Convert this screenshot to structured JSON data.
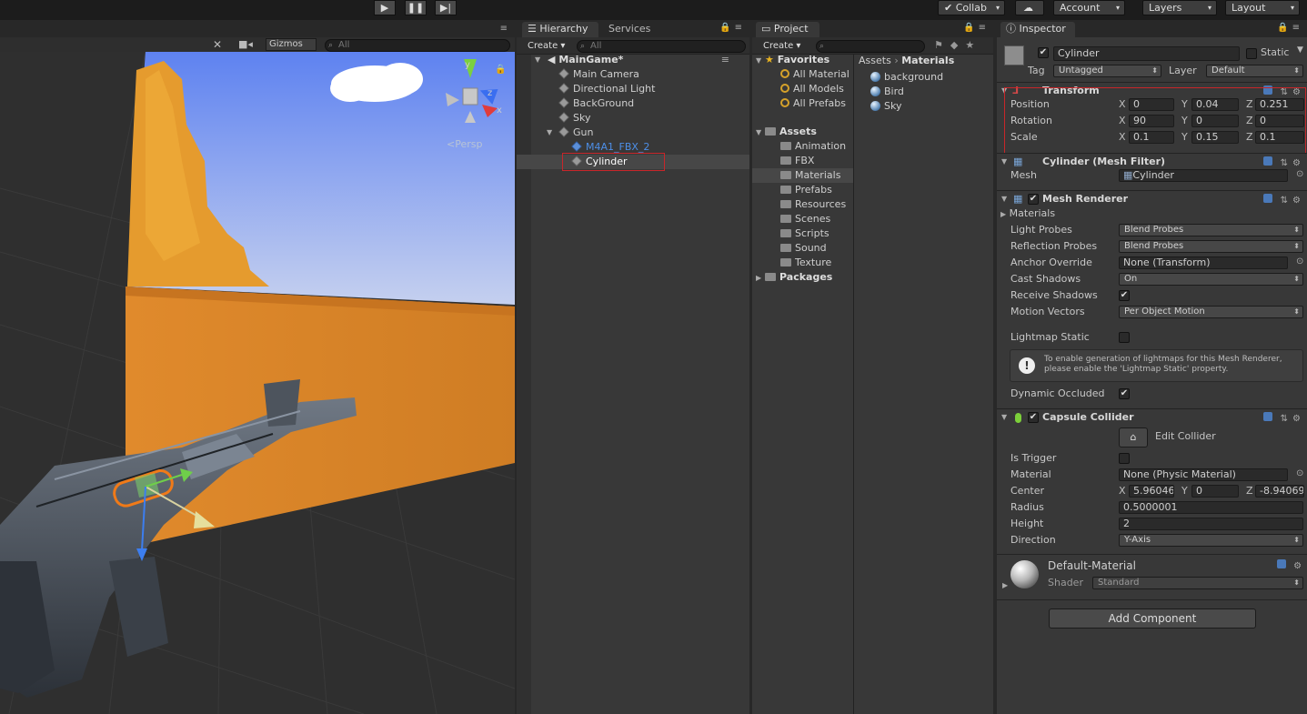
{
  "toolbar": {
    "play_icon": "play-icon",
    "pause_icon": "pause-icon",
    "step_icon": "step-icon",
    "collab_label": "Collab",
    "account_label": "Account",
    "layers_label": "Layers",
    "layout_label": "Layout"
  },
  "scene": {
    "toolbar": {
      "gizmos_label": "Gizmos",
      "search_placeholder": "All"
    },
    "persp_label": "<Persp",
    "axis_labels": {
      "y": "y",
      "z": "z",
      "x": "x"
    }
  },
  "hierarchy": {
    "tabs": [
      "Hierarchy",
      "Services"
    ],
    "create_label": "Create",
    "search_placeholder": "All",
    "scene_name": "MainGame*",
    "items": [
      {
        "label": "Main Camera",
        "depth": 1
      },
      {
        "label": "Directional Light",
        "depth": 1
      },
      {
        "label": "BackGround",
        "depth": 1
      },
      {
        "label": "Sky",
        "depth": 1
      },
      {
        "label": "Gun",
        "depth": 1,
        "expanded": true
      },
      {
        "label": "M4A1_FBX_2",
        "depth": 2,
        "prefab": true
      },
      {
        "label": "Cylinder",
        "depth": 2,
        "selected": true
      }
    ]
  },
  "project": {
    "tab": "Project",
    "create_label": "Create",
    "favorites_label": "Favorites",
    "favorites": [
      "All Material",
      "All Models",
      "All Prefabs"
    ],
    "assets_label": "Assets",
    "asset_folders": [
      "Animation",
      "FBX",
      "Materials",
      "Prefabs",
      "Resources",
      "Scenes",
      "Scripts",
      "Sound",
      "Texture"
    ],
    "selected_folder": "Materials",
    "packages_label": "Packages",
    "breadcrumb": [
      "Assets",
      "Materials"
    ],
    "materials": [
      "background",
      "Bird",
      "Sky"
    ]
  },
  "inspector": {
    "tab": "Inspector",
    "object_name": "Cylinder",
    "static_label": "Static",
    "tag_label": "Tag",
    "tag_value": "Untagged",
    "layer_label": "Layer",
    "layer_value": "Default",
    "transform": {
      "title": "Transform",
      "position_label": "Position",
      "rotation_label": "Rotation",
      "scale_label": "Scale",
      "position": {
        "x": "0",
        "y": "0.04",
        "z": "0.251"
      },
      "rotation": {
        "x": "90",
        "y": "0",
        "z": "0"
      },
      "scale": {
        "x": "0.1",
        "y": "0.15",
        "z": "0.1"
      }
    },
    "mesh_filter": {
      "title": "Cylinder (Mesh Filter)",
      "mesh_label": "Mesh",
      "mesh_value": "Cylinder"
    },
    "mesh_renderer": {
      "title": "Mesh Renderer",
      "materials_label": "Materials",
      "light_probes_label": "Light Probes",
      "light_probes_value": "Blend Probes",
      "reflection_probes_label": "Reflection Probes",
      "reflection_probes_value": "Blend Probes",
      "anchor_override_label": "Anchor Override",
      "anchor_override_value": "None (Transform)",
      "cast_shadows_label": "Cast Shadows",
      "cast_shadows_value": "On",
      "receive_shadows_label": "Receive Shadows",
      "motion_vectors_label": "Motion Vectors",
      "motion_vectors_value": "Per Object Motion",
      "lightmap_static_label": "Lightmap Static",
      "info_text": "To enable generation of lightmaps for this Mesh Renderer, please enable the 'Lightmap Static' property.",
      "dynamic_occluded_label": "Dynamic Occluded"
    },
    "capsule_collider": {
      "title": "Capsule Collider",
      "edit_label": "Edit Collider",
      "is_trigger_label": "Is Trigger",
      "material_label": "Material",
      "material_value": "None (Physic Material)",
      "center_label": "Center",
      "center": {
        "x": "5.960464",
        "y": "0",
        "z": "-8.94069"
      },
      "radius_label": "Radius",
      "radius_value": "0.5000001",
      "height_label": "Height",
      "height_value": "2",
      "direction_label": "Direction",
      "direction_value": "Y-Axis"
    },
    "material": {
      "name": "Default-Material",
      "shader_label": "Shader",
      "shader_value": "Standard"
    },
    "add_component_label": "Add Component"
  },
  "colors": {
    "selection_outline": "#c8262a",
    "sky_top": "#5f86f2",
    "wall": "#d9862d",
    "prefab_text": "#4d8ee6"
  }
}
